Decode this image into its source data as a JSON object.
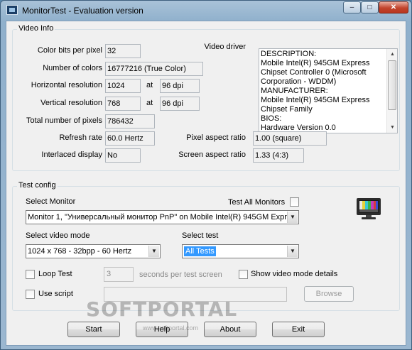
{
  "window": {
    "title": "MonitorTest - Evaluation version",
    "caption_min": "–",
    "caption_max": "□",
    "caption_close": "✕"
  },
  "video_info": {
    "group_label": "Video Info",
    "color_bits_label": "Color bits per pixel",
    "color_bits_value": "32",
    "num_colors_label": "Number of colors",
    "num_colors_value": "16777216 (True Color)",
    "hres_label": "Horizontal resolution",
    "hres_value": "1024",
    "hres_at": "at",
    "hres_dpi": "96 dpi",
    "vres_label": "Vertical resolution",
    "vres_value": "768",
    "vres_at": "at",
    "vres_dpi": "96 dpi",
    "total_pixels_label": "Total number of pixels",
    "total_pixels_value": "786432",
    "refresh_label": "Refresh rate",
    "refresh_value": "60.0 Hertz",
    "interlaced_label": "Interlaced display",
    "interlaced_value": "No",
    "pixel_aspect_label": "Pixel aspect ratio",
    "pixel_aspect_value": "1.00 (square)",
    "screen_aspect_label": "Screen aspect ratio",
    "screen_aspect_value": "1.33 (4:3)",
    "driver_label": "Video driver",
    "driver_lines": [
      "DESCRIPTION:",
      "Mobile Intel(R) 945GM Express",
      "Chipset Controller 0 (Microsoft",
      "Corporation - WDDM)",
      "MANUFACTURER:",
      "Mobile Intel(R) 945GM Express",
      "Chipset Family",
      "BIOS:",
      "Hardware Version 0.0"
    ]
  },
  "test_config": {
    "group_label": "Test config",
    "select_monitor_label": "Select Monitor",
    "test_all_label": "Test All Monitors",
    "monitor_value": "Monitor 1, \"Универсальный монитор PnP\" on Mobile Intel(R) 945GM Expre",
    "video_mode_label": "Select video mode",
    "video_mode_value": "1024 x 768 - 32bpp - 60 Hertz",
    "select_test_label": "Select test",
    "select_test_value": "All Tests",
    "loop_label": "Loop Test",
    "loop_seconds": "3",
    "seconds_label": "seconds per test screen",
    "show_details_label": "Show video mode details",
    "use_script_label": "Use script",
    "script_path": "",
    "browse_label": "Browse"
  },
  "buttons": {
    "start": "Start",
    "help": "Help",
    "about": "About",
    "exit": "Exit"
  },
  "watermark": {
    "text": "SOFTPORTAL",
    "url": "www.softportal.com"
  },
  "icons": {
    "app": "monitor-test-app-icon",
    "monitor": "monitor-test-pattern-icon"
  },
  "colors": {
    "selection": "#3399ff",
    "close_button": "#c2442d",
    "titlebar": "#a9c2d8"
  }
}
